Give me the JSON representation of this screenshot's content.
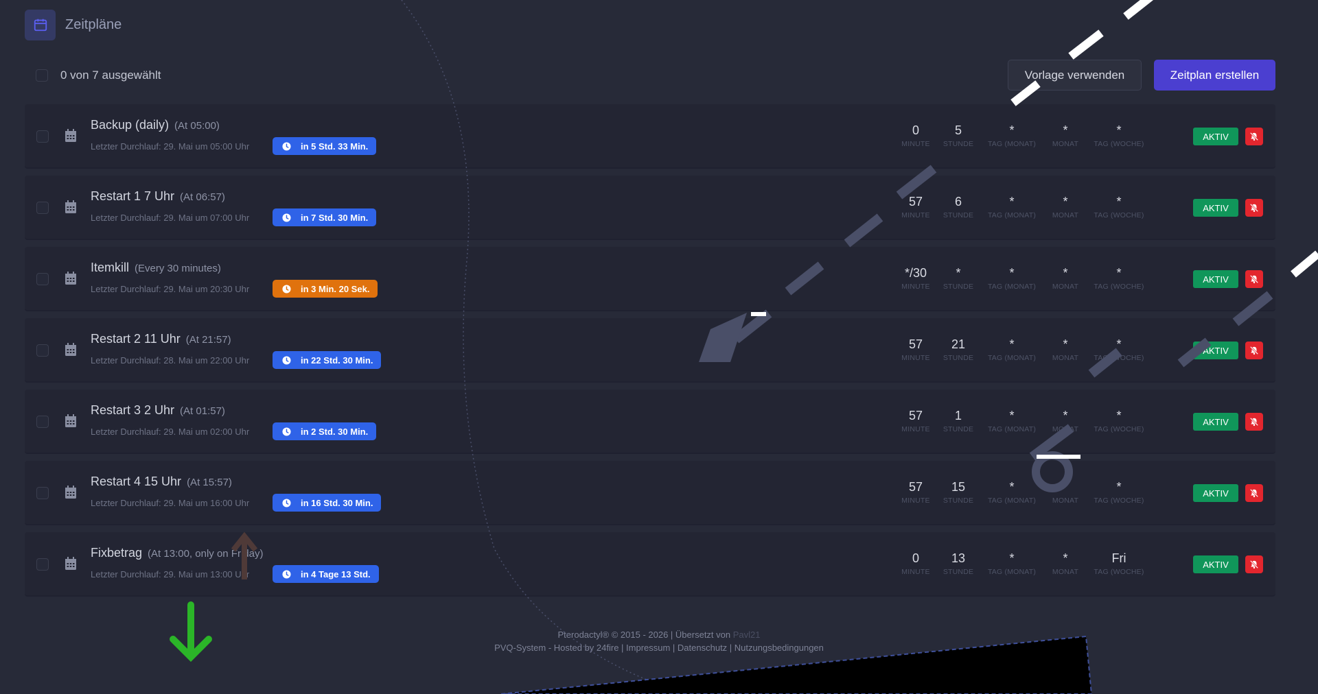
{
  "header": {
    "title": "Zeitpläne",
    "icon": "calendar-icon"
  },
  "selection": {
    "count_text": "0 von 7 ausgewählt"
  },
  "actions": {
    "template_label": "Vorlage verwenden",
    "create_label": "Zeitplan erstellen"
  },
  "cron_labels": {
    "minute": "MINUTE",
    "hour": "STUNDE",
    "day_month": "TAG (MONAT)",
    "month": "MONAT",
    "day_week": "TAG (WOCHE)"
  },
  "schedules": [
    {
      "name": "Backup (daily)",
      "when": "(At 05:00)",
      "last_run": "Letzter Durchlauf: 29. Mai um 05:00 Uhr",
      "next": "in 5 Std. 33 Min.",
      "next_warn": false,
      "minute": "0",
      "hour": "5",
      "day_month": "*",
      "month": "*",
      "day_week": "*",
      "status": "AKTIV"
    },
    {
      "name": "Restart 1 7 Uhr",
      "when": "(At 06:57)",
      "last_run": "Letzter Durchlauf: 29. Mai um 07:00 Uhr",
      "next": "in 7 Std. 30 Min.",
      "next_warn": false,
      "minute": "57",
      "hour": "6",
      "day_month": "*",
      "month": "*",
      "day_week": "*",
      "status": "AKTIV"
    },
    {
      "name": "Itemkill",
      "when": "(Every 30 minutes)",
      "last_run": "Letzter Durchlauf: 29. Mai um 20:30 Uhr",
      "next": "in 3 Min. 20 Sek.",
      "next_warn": true,
      "minute": "*/30",
      "hour": "*",
      "day_month": "*",
      "month": "*",
      "day_week": "*",
      "status": "AKTIV"
    },
    {
      "name": "Restart 2 11 Uhr",
      "when": "(At 21:57)",
      "last_run": "Letzter Durchlauf: 28. Mai um 22:00 Uhr",
      "next": "in 22 Std. 30 Min.",
      "next_warn": false,
      "minute": "57",
      "hour": "21",
      "day_month": "*",
      "month": "*",
      "day_week": "*",
      "status": "AKTIV"
    },
    {
      "name": "Restart 3 2 Uhr",
      "when": "(At 01:57)",
      "last_run": "Letzter Durchlauf: 29. Mai um 02:00 Uhr",
      "next": "in 2 Std. 30 Min.",
      "next_warn": false,
      "minute": "57",
      "hour": "1",
      "day_month": "*",
      "month": "*",
      "day_week": "*",
      "status": "AKTIV"
    },
    {
      "name": "Restart 4 15 Uhr",
      "when": "(At 15:57)",
      "last_run": "Letzter Durchlauf: 29. Mai um 16:00 Uhr",
      "next": "in 16 Std. 30 Min.",
      "next_warn": false,
      "minute": "57",
      "hour": "15",
      "day_month": "*",
      "month": "*",
      "day_week": "*",
      "status": "AKTIV"
    },
    {
      "name": "Fixbetrag",
      "when": "(At 13:00, only on Friday)",
      "last_run": "Letzter Durchlauf: 29. Mai um 13:00 Uhr",
      "next": "in 4 Tage 13 Std.",
      "next_warn": false,
      "minute": "0",
      "hour": "13",
      "day_month": "*",
      "month": "*",
      "day_week": "Fri",
      "status": "AKTIV"
    }
  ],
  "footer": {
    "copyright": "Pterodactyl® © 2015 - 2026 | Übersetzt von ",
    "translator": "Pavl21",
    "hosting": "PVQ-System - Hosted by 24fire | Impressum | Datenschutz | Nutzungsbedingungen"
  },
  "colors": {
    "background": "#272a38",
    "row": "#232533",
    "accent": "#4b3fd0",
    "badge_blue": "#2f63e8",
    "badge_orange": "#e0720d",
    "active": "#10965a",
    "danger": "#e3262e"
  }
}
